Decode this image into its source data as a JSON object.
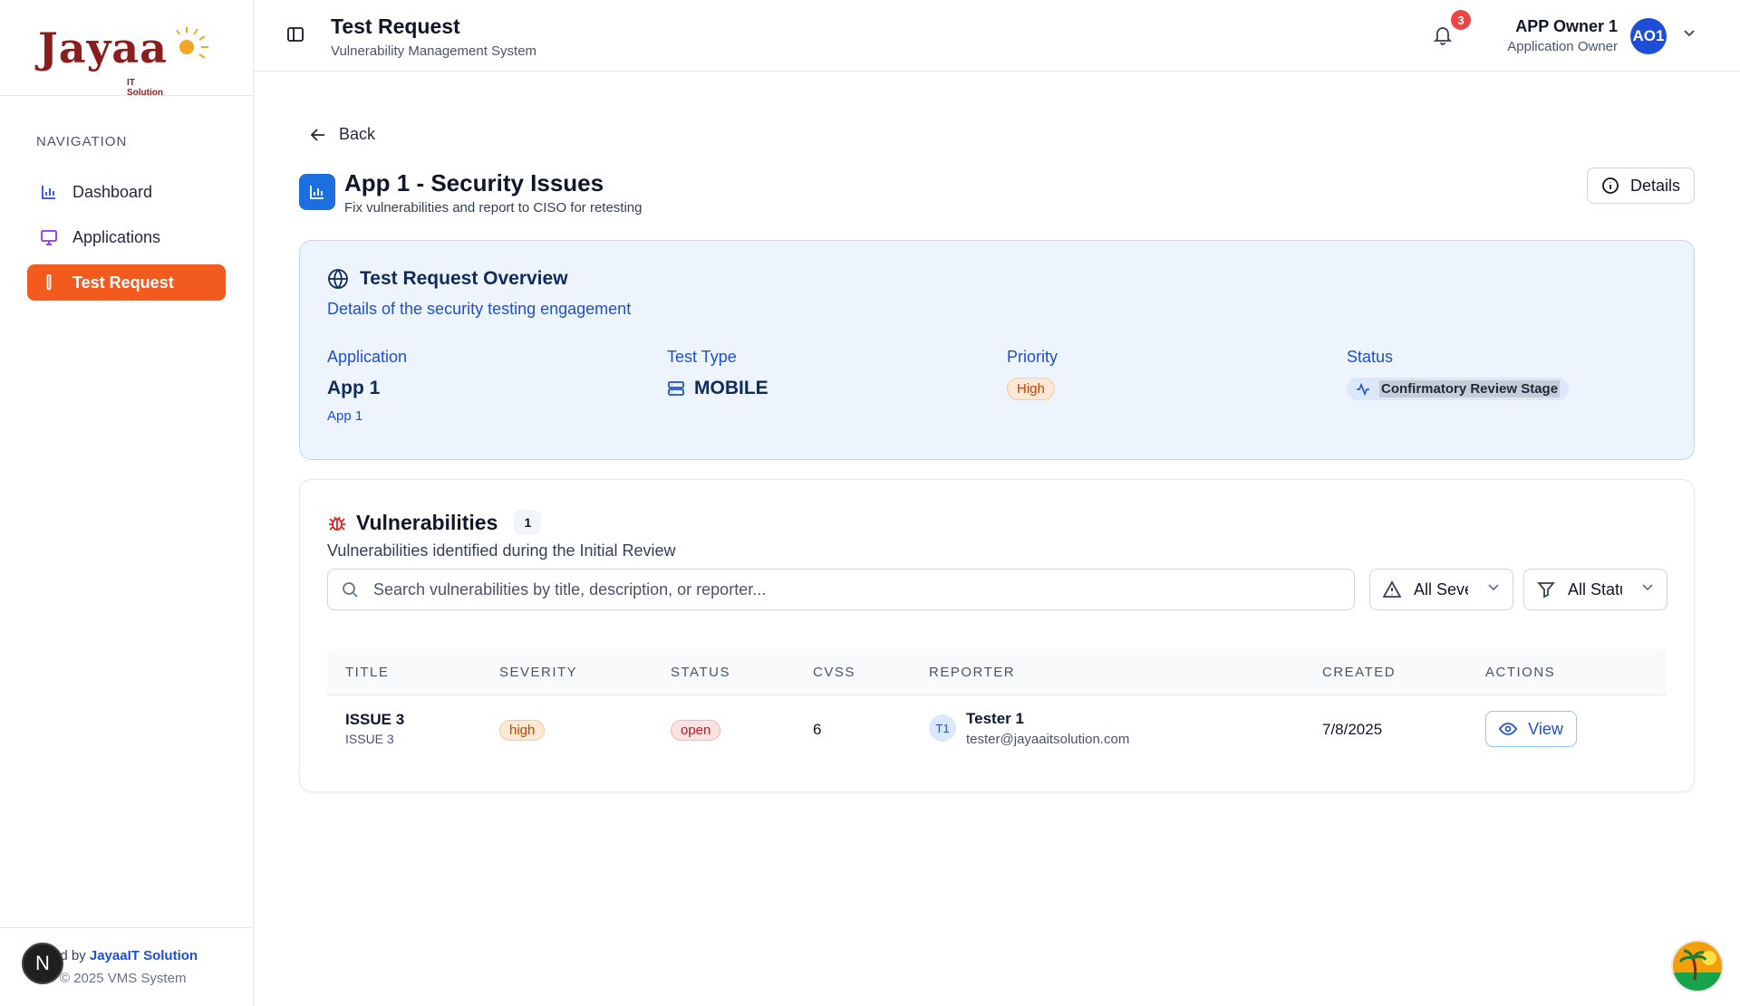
{
  "logo": {
    "text": "Jayaa",
    "sub": "IT Solution"
  },
  "sidebar": {
    "heading": "NAVIGATION",
    "items": [
      {
        "label": "Dashboard",
        "icon": "bar-chart-icon",
        "active": false
      },
      {
        "label": "Applications",
        "icon": "monitor-icon",
        "active": false
      },
      {
        "label": "Test Request",
        "icon": "test-tube-icon",
        "active": true
      }
    ],
    "footer": {
      "prefix": "ed by ",
      "brand": "JayaaIT Solution",
      "copyright": "© 2025 VMS System",
      "badge": "N"
    }
  },
  "header": {
    "title": "Test Request",
    "subtitle": "Vulnerability Management System",
    "notifications": "3",
    "user_name": "APP Owner 1",
    "user_role": "Application Owner",
    "avatar": "AO1"
  },
  "page": {
    "back_label": "Back",
    "title": "App 1 - Security Issues",
    "subtitle": "Fix vulnerabilities and report to CISO for retesting",
    "details_label": "Details"
  },
  "overview": {
    "title": "Test Request Overview",
    "subtitle": "Details of the security testing engagement",
    "application_label": "Application",
    "application_value": "App 1",
    "application_sub": "App 1",
    "test_type_label": "Test Type",
    "test_type_value": "MOBILE",
    "priority_label": "Priority",
    "priority_value": "High",
    "status_label": "Status",
    "status_value": "Confirmatory Review Stage"
  },
  "vulnerabilities": {
    "title": "Vulnerabilities",
    "count": "1",
    "subtitle": "Vulnerabilities identified during the Initial Review",
    "search_placeholder": "Search vulnerabilities by title, description, or reporter...",
    "severity_filter": "All Severities",
    "status_filter": "All Statuses",
    "columns": [
      "TITLE",
      "SEVERITY",
      "STATUS",
      "CVSS",
      "REPORTER",
      "CREATED",
      "ACTIONS"
    ],
    "rows": [
      {
        "title": "ISSUE 3",
        "description": "ISSUE 3",
        "severity": "high",
        "status": "open",
        "cvss": "6",
        "reporter_initials": "T1",
        "reporter_name": "Tester 1",
        "reporter_email": "tester@jayaaitsolution.com",
        "created": "7/8/2025",
        "action": "View"
      }
    ]
  },
  "colors": {
    "accent": "#f25a1e",
    "primary": "#1d4ed8",
    "overview_bg": "#eef4fd"
  }
}
